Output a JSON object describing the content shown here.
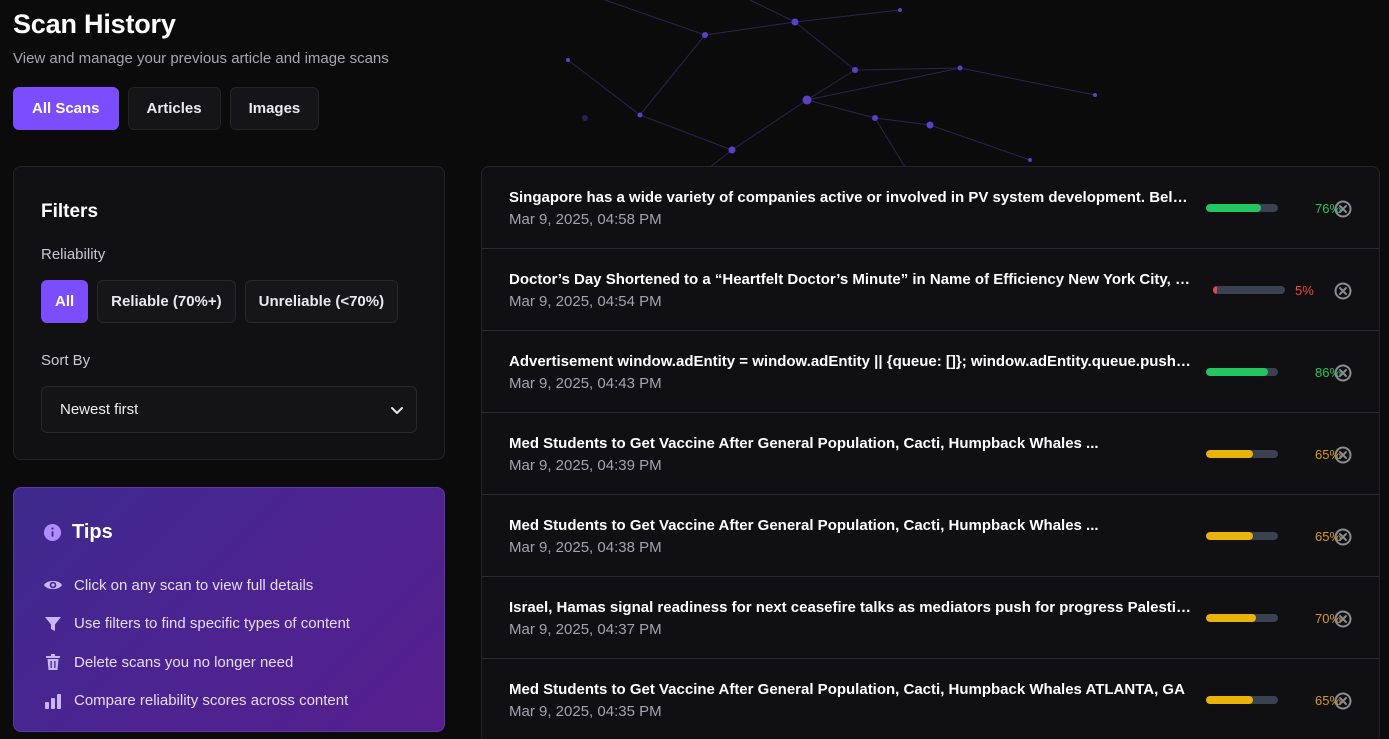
{
  "header": {
    "title": "Scan History",
    "subtitle": "View and manage your previous article and image scans"
  },
  "tabs": [
    {
      "label": "All Scans",
      "active": true
    },
    {
      "label": "Articles",
      "active": false
    },
    {
      "label": "Images",
      "active": false
    }
  ],
  "filters": {
    "title": "Filters",
    "reliability_label": "Reliability",
    "reliability_options": [
      {
        "label": "All",
        "active": true
      },
      {
        "label": "Reliable (70%+)",
        "active": false
      },
      {
        "label": "Unreliable (<70%)",
        "active": false
      }
    ],
    "sort_label": "Sort By",
    "sort_value": "Newest first"
  },
  "tips": {
    "title": "Tips",
    "icon": "info-icon",
    "items": [
      {
        "icon": "eye-icon",
        "text": "Click on any scan to view full details"
      },
      {
        "icon": "filter-icon",
        "text": "Use filters to find specific types of content"
      },
      {
        "icon": "trash-icon",
        "text": "Delete scans you no longer need"
      },
      {
        "icon": "bar-chart-icon",
        "text": "Compare reliability scores across content"
      }
    ]
  },
  "colors": {
    "accent": "#7c4dff",
    "green": "#22c55e",
    "yellow": "#eab308",
    "red": "#ef4444"
  },
  "scans": [
    {
      "title": "Singapore has a wide variety of companies active or involved in PV system development. Below is a list of notable companies",
      "date": "Mar 9, 2025, 04:58 PM",
      "score": 76,
      "score_label": "76%",
      "color": "#22c55e",
      "text_color": "#22c55e"
    },
    {
      "title": "Doctor’s Day Shortened to a “Heartfelt Doctor’s Minute” in Name of Efficiency New York City, NY",
      "date": "Mar 9, 2025, 04:54 PM",
      "score": 5,
      "score_label": "5%",
      "color": "#ef4444",
      "text_color": "#ef4444"
    },
    {
      "title": "Advertisement window.adEntity = window.adEntity || {queue: []}; window.adEntity.queue.push(function(){",
      "date": "Mar 9, 2025, 04:43 PM",
      "score": 86,
      "score_label": "86%",
      "color": "#22c55e",
      "text_color": "#22c55e"
    },
    {
      "title": "Med Students to Get Vaccine After General Population, Cacti, Humpback Whales ...",
      "date": "Mar 9, 2025, 04:39 PM",
      "score": 65,
      "score_label": "65%",
      "color": "#eab308",
      "text_color": "#d99a10"
    },
    {
      "title": "Med Students to Get Vaccine After General Population, Cacti, Humpback Whales ...",
      "date": "Mar 9, 2025, 04:38 PM",
      "score": 65,
      "score_label": "65%",
      "color": "#eab308",
      "text_color": "#d99a10"
    },
    {
      "title": "Israel, Hamas signal readiness for next ceasefire talks as mediators push for progress Palestinians",
      "date": "Mar 9, 2025, 04:37 PM",
      "score": 70,
      "score_label": "70%",
      "color": "#eab308",
      "text_color": "#d99a10"
    },
    {
      "title": "Med Students to Get Vaccine After General Population, Cacti, Humpback Whales ATLANTA, GA",
      "date": "Mar 9, 2025, 04:35 PM",
      "score": 65,
      "score_label": "65%",
      "color": "#eab308",
      "text_color": "#d99a10"
    }
  ]
}
